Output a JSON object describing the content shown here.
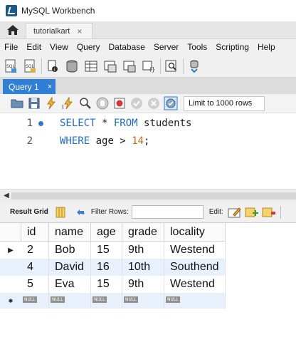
{
  "window": {
    "title": "MySQL Workbench"
  },
  "connection_tab": {
    "label": "tutorialkart",
    "close": "×"
  },
  "menu": [
    "File",
    "Edit",
    "View",
    "Query",
    "Database",
    "Server",
    "Tools",
    "Scripting",
    "Help"
  ],
  "query_tab": {
    "label": "Query 1",
    "close": "×"
  },
  "editor_toolbar": {
    "limit_label": "Limit to 1000 rows"
  },
  "editor": {
    "lines": [
      {
        "num": "1",
        "kw1": "SELECT",
        "mid1": " * ",
        "kw2": "FROM",
        "rest": " students"
      },
      {
        "num": "2",
        "kw1": "WHERE",
        "mid1": " age > ",
        "numval": "14",
        "rest": ";"
      }
    ]
  },
  "results": {
    "grid_label": "Result Grid",
    "filter_label": "Filter Rows:",
    "filter_value": "",
    "edit_label": "Edit:",
    "columns": [
      "id",
      "name",
      "age",
      "grade",
      "locality"
    ],
    "rows": [
      [
        "2",
        "Bob",
        "15",
        "9th",
        "Westend"
      ],
      [
        "4",
        "David",
        "16",
        "10th",
        "Southend"
      ],
      [
        "5",
        "Eva",
        "15",
        "9th",
        "Westend"
      ]
    ],
    "null_text": "NULL",
    "current_row_marker": "▶",
    "new_row_marker": "✱"
  },
  "colors": {
    "accent": "#2f7fd6",
    "keyword": "#1a6bd6",
    "number": "#c76b1a",
    "selected_row": "#e8f0fb"
  }
}
